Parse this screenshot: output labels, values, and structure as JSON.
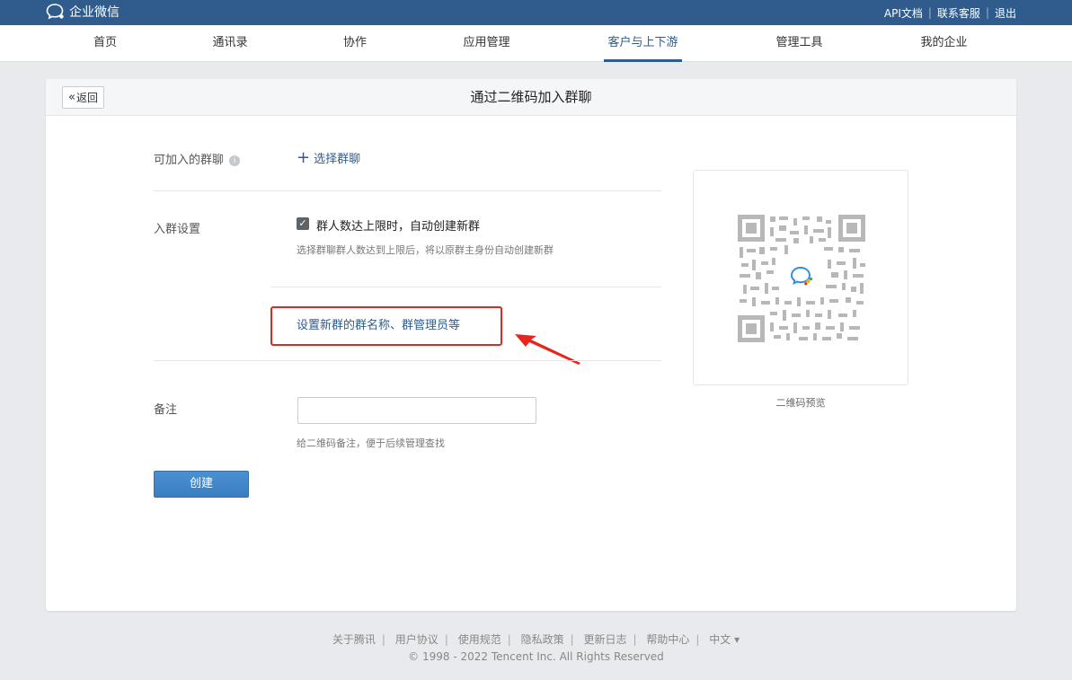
{
  "app": {
    "logo_text": "企业微信"
  },
  "top_links": [
    "API文档",
    "联系客服",
    "退出"
  ],
  "nav": {
    "items": [
      "首页",
      "通讯录",
      "协作",
      "应用管理",
      "客户与上下游",
      "管理工具",
      "我的企业"
    ],
    "active_index": 4
  },
  "page": {
    "back_label": "返回",
    "title": "通过二维码加入群聊"
  },
  "form": {
    "group_label": "可加入的群聊",
    "select_group_label": "选择群聊",
    "settings_label": "入群设置",
    "auto_create_label": "群人数达上限时，自动创建新群",
    "auto_create_checked": true,
    "auto_create_hint": "选择群聊群人数达到上限后，将以原群主身份自动创建新群",
    "new_group_settings_link": "设置新群的群名称、群管理员等",
    "remark_label": "备注",
    "remark_value": "",
    "remark_placeholder": "",
    "remark_hint": "给二维码备注，便于后续管理查找",
    "create_button": "创建"
  },
  "qr": {
    "caption": "二维码预览"
  },
  "footer": {
    "links": [
      "关于腾讯",
      "用户协议",
      "使用规范",
      "隐私政策",
      "更新日志",
      "帮助中心",
      "中文 ▾"
    ],
    "copyright": "© 1998 - 2022 Tencent Inc. All Rights Reserved"
  },
  "colors": {
    "header_bg": "#2f5c8c",
    "accent": "#2f5c8c",
    "button": "#3b7dc0",
    "highlight": "#e8251a"
  }
}
